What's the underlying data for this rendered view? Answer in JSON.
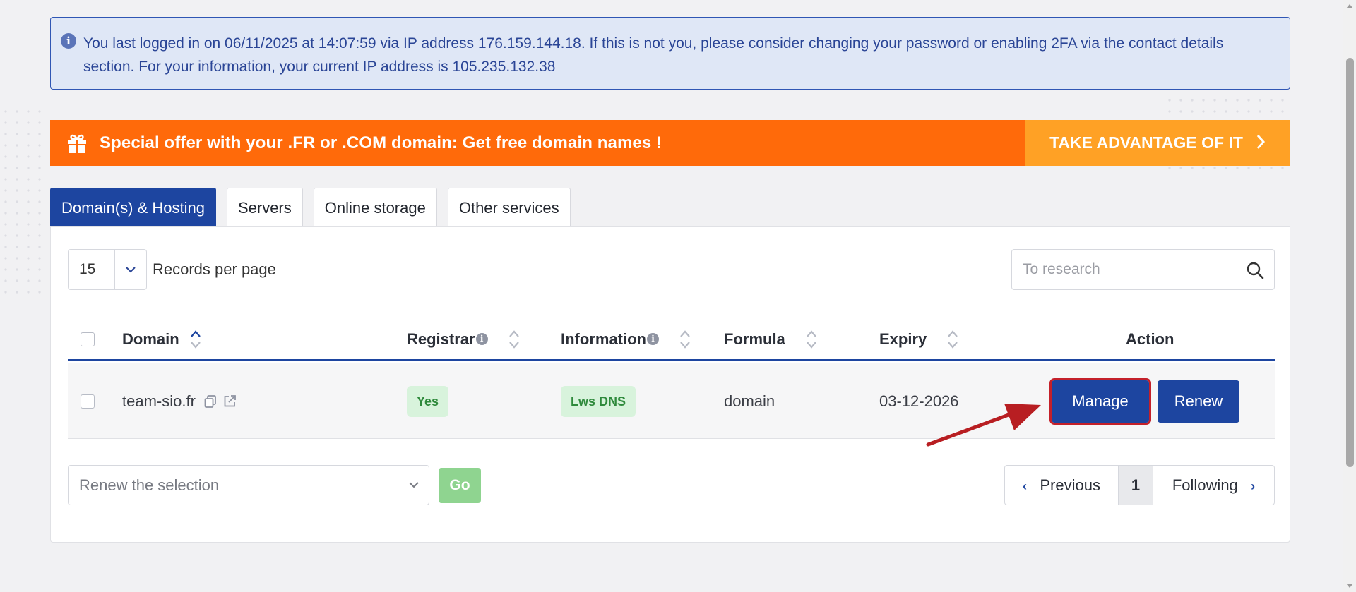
{
  "alert": {
    "icon": "info-icon",
    "text": "You last logged in on 06/11/2025 at 14:07:59 via IP address 176.159.144.18. If this is not you, please consider changing your password or enabling 2FA via the contact details section. For your information, your current IP address is 105.235.132.38"
  },
  "promo": {
    "icon": "gift-icon",
    "text": "Special offer with your .FR or .COM domain: Get free domain names !",
    "cta": "TAKE ADVANTAGE OF IT",
    "colors": {
      "banner": "#ff6a0a",
      "cta": "#ffa125"
    }
  },
  "tabs": [
    {
      "label": "Domain(s) & Hosting",
      "active": true
    },
    {
      "label": "Servers"
    },
    {
      "label": "Online storage"
    },
    {
      "label": "Other services"
    }
  ],
  "records": {
    "value": "15",
    "label": "Records per page"
  },
  "search": {
    "placeholder": "To research"
  },
  "table": {
    "columns": [
      "Domain",
      "Registrar",
      "Information",
      "Formula",
      "Expiry",
      "Action"
    ],
    "rows": [
      {
        "domain": "team-sio.fr",
        "registrar": "Yes",
        "information": "Lws DNS",
        "formula": "domain",
        "expiry": "03-12-2026",
        "actions": [
          "Manage",
          "Renew"
        ]
      }
    ]
  },
  "bulk": {
    "value": "Renew the selection",
    "go": "Go"
  },
  "pagination": {
    "previous": "Previous",
    "page": "1",
    "next": "Following"
  },
  "colors": {
    "primary": "#1d45a0",
    "highlight": "#c4202a",
    "success": "#2f8a3c"
  }
}
